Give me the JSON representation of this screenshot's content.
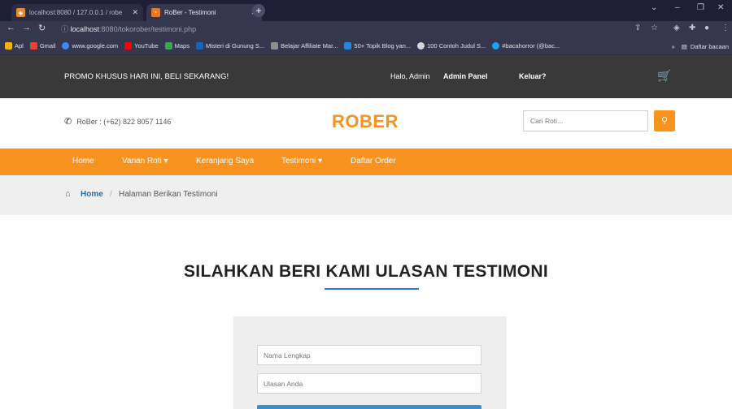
{
  "browser": {
    "tabs": [
      {
        "title": "localhost:8080 / 127.0.0.1 / robe"
      },
      {
        "title": "RoBer - Testimoni"
      }
    ],
    "url_host": "localhost",
    "url_rest": ":8080/tokorober/testimoni.php",
    "bookmarks": [
      {
        "label": "Apl",
        "color": "#f4b400"
      },
      {
        "label": "Gmail",
        "color": "#ea4335"
      },
      {
        "label": "www.google.com",
        "color": "#4285f4"
      },
      {
        "label": "YouTube",
        "color": "#ff0000"
      },
      {
        "label": "Maps",
        "color": "#34a853"
      },
      {
        "label": "Misteri di Gunung S...",
        "color": "#1565c0"
      },
      {
        "label": "Belajar Affiliate Mar...",
        "color": "#8e8e8e"
      },
      {
        "label": "50+ Topik Blog yan...",
        "color": "#1e88e5"
      },
      {
        "label": "100 Contoh Judul S...",
        "color": "#cfd8dc"
      },
      {
        "label": "#bacahorror (@bac...",
        "color": "#1da1f2"
      }
    ],
    "bookmarks_more": "»",
    "reading_list": "Daftar bacaan"
  },
  "promo": {
    "text": "PROMO KHUSUS HARI INI, BELI SEKARANG!",
    "greeting": "Halo, Admin",
    "admin_panel": "Admin Panel",
    "logout": "Keluar?"
  },
  "header": {
    "phone": "RoBer : (+62) 822 8057 1146",
    "logo": "ROBER",
    "search_placeholder": "Cari Roti..."
  },
  "nav": {
    "items": [
      "Home",
      "Varian Roti ▾",
      "Keranjang Saya",
      "Testimoni ▾",
      "Daftar Order"
    ]
  },
  "breadcrumb": {
    "home": "Home",
    "separator": "/",
    "current": "Halaman Berikan Testimoni"
  },
  "main": {
    "title": "SILAHKAN BERI KAMI ULASAN TESTIMONI",
    "name_placeholder": "Nama Lengkap",
    "review_placeholder": "Ulasan Anda"
  },
  "colors": {
    "accent": "#f7931e",
    "link": "#1f6fb5",
    "dark_bar": "#393939"
  }
}
